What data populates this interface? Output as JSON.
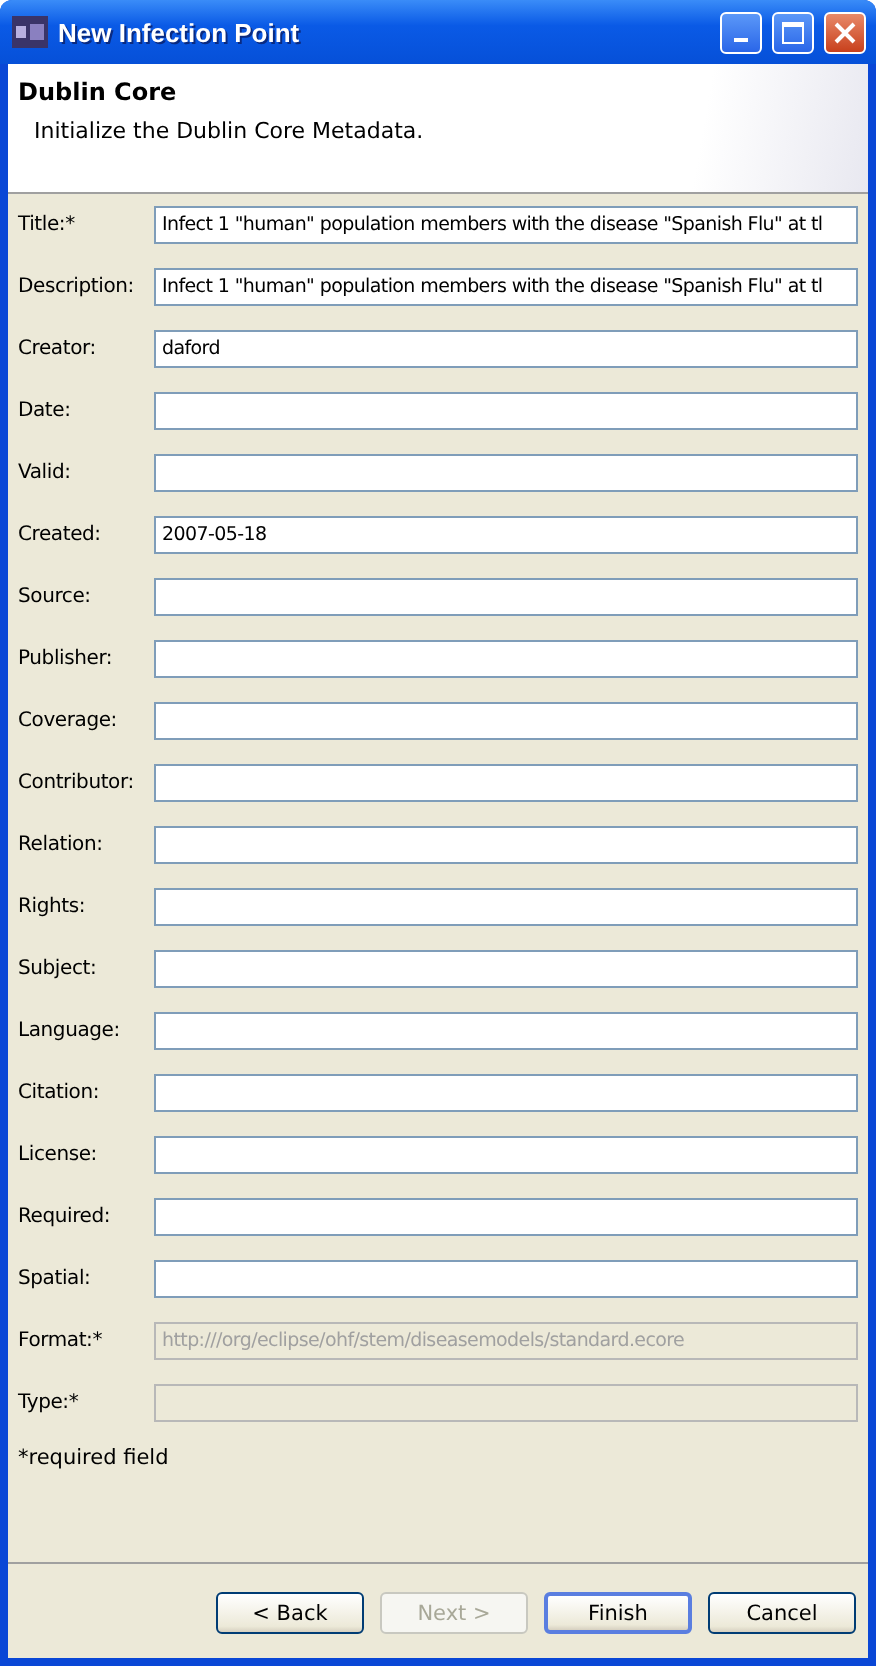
{
  "window": {
    "title": "New Infection Point"
  },
  "header": {
    "title": "Dublin Core",
    "subtitle": "Initialize the Dublin Core Metadata."
  },
  "fields": [
    {
      "label": "Title:*",
      "value": "Infect 1 \"human\" population members with the disease \"Spanish Flu\" at tl",
      "disabled": false
    },
    {
      "label": "Description:",
      "value": "Infect 1 \"human\" population members with the disease \"Spanish Flu\" at tl",
      "disabled": false
    },
    {
      "label": "Creator:",
      "value": "daford",
      "disabled": false
    },
    {
      "label": "Date:",
      "disabled": false
    },
    {
      "label": "Valid:",
      "disabled": false
    },
    {
      "label": "Created:",
      "value": "2007-05-18",
      "disabled": false
    },
    {
      "label": "Source:",
      "disabled": false
    },
    {
      "label": "Publisher:",
      "disabled": false
    },
    {
      "label": "Coverage:",
      "disabled": false
    },
    {
      "label": "Contributor:",
      "disabled": false
    },
    {
      "label": "Relation:",
      "disabled": false
    },
    {
      "label": "Rights:",
      "disabled": false
    },
    {
      "label": "Subject:",
      "disabled": false
    },
    {
      "label": "Language:",
      "disabled": false
    },
    {
      "label": "Citation:",
      "disabled": false
    },
    {
      "label": "License:",
      "disabled": false
    },
    {
      "label": "Required:",
      "disabled": false
    },
    {
      "label": "Spatial:",
      "disabled": false
    },
    {
      "label": "Format:*",
      "value": "http:///org/eclipse/ohf/stem/diseasemodels/standard.ecore",
      "disabled": true
    },
    {
      "label": "Type:*",
      "disabled": true
    }
  ],
  "note": "*required field",
  "buttons": [
    {
      "label": "< Back",
      "disabled": false,
      "default": false
    },
    {
      "label": "Next >",
      "disabled": true,
      "default": false
    },
    {
      "label": "Finish",
      "disabled": false,
      "default": true
    },
    {
      "label": "Cancel",
      "disabled": false,
      "default": false
    }
  ]
}
